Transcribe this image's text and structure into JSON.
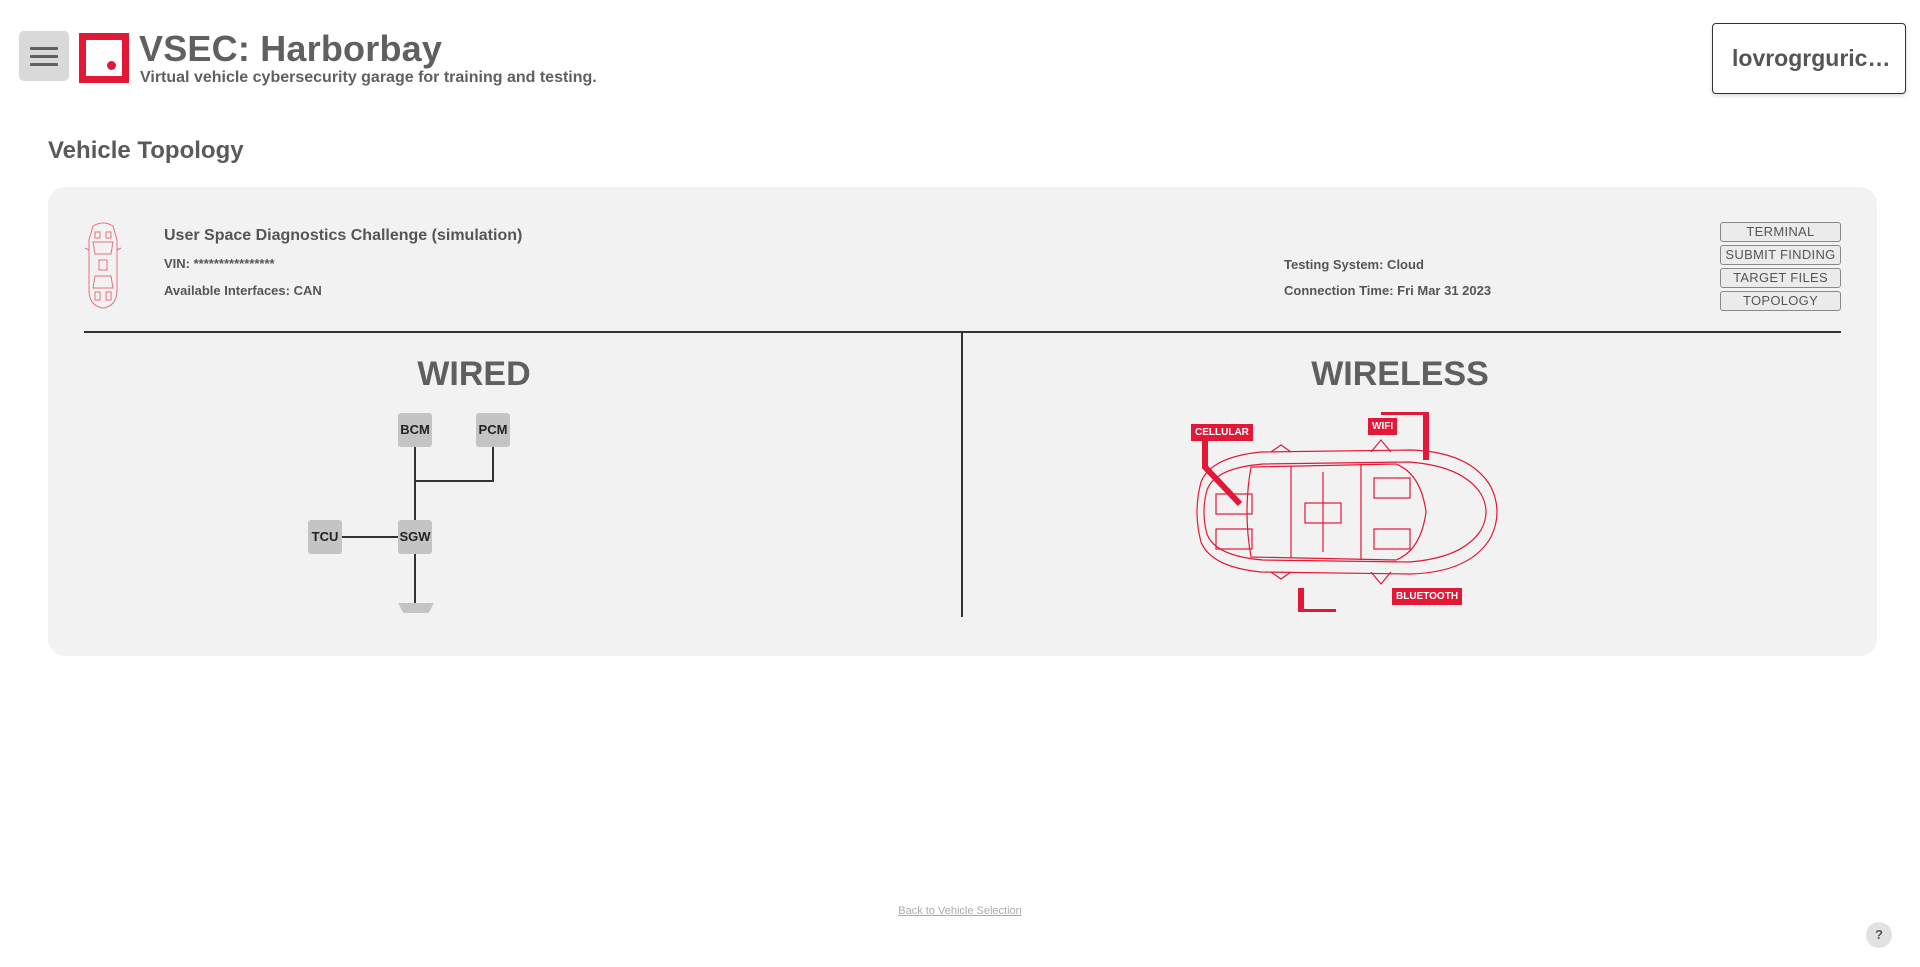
{
  "header": {
    "menu_icon": "hamburger-menu-icon",
    "logo_icon": "vsec-logo",
    "title": "VSEC: Harborbay",
    "subtitle": "Virtual vehicle cybersecurity garage for training and testing.",
    "user_label": "lovrogrguric…"
  },
  "page": {
    "heading": "Vehicle Topology"
  },
  "vehicle": {
    "thumbnail_icon": "car-outline-icon",
    "challenge_title": "User Space Diagnostics Challenge (simulation)",
    "vin": "VIN: ****************",
    "interfaces": "Available Interfaces: CAN",
    "testing_system": "Testing System: Cloud",
    "connection_time": "Connection Time: Fri Mar 31 2023"
  },
  "actions": {
    "terminal": "TERMINAL",
    "submit_finding": "SUBMIT FINDING",
    "target_files": "TARGET FILES",
    "topology": "TOPOLOGY"
  },
  "wired": {
    "heading": "WIRED",
    "nodes": {
      "bcm": "BCM",
      "pcm": "PCM",
      "tcu": "TCU",
      "sgw": "SGW"
    }
  },
  "wireless": {
    "heading": "WIRELESS",
    "car_icon": "car-topdown-icon",
    "interfaces": {
      "cellular": "CELLULAR",
      "wifi": "WIFI",
      "bluetooth": "BLUETOOTH"
    }
  },
  "footer": {
    "back_link": "Back to Vehicle Selection",
    "help": "?"
  },
  "colors": {
    "accent": "#e31837",
    "panel_bg": "#f2f2f2",
    "node_bg": "#c4c4c4",
    "text": "#555555"
  }
}
